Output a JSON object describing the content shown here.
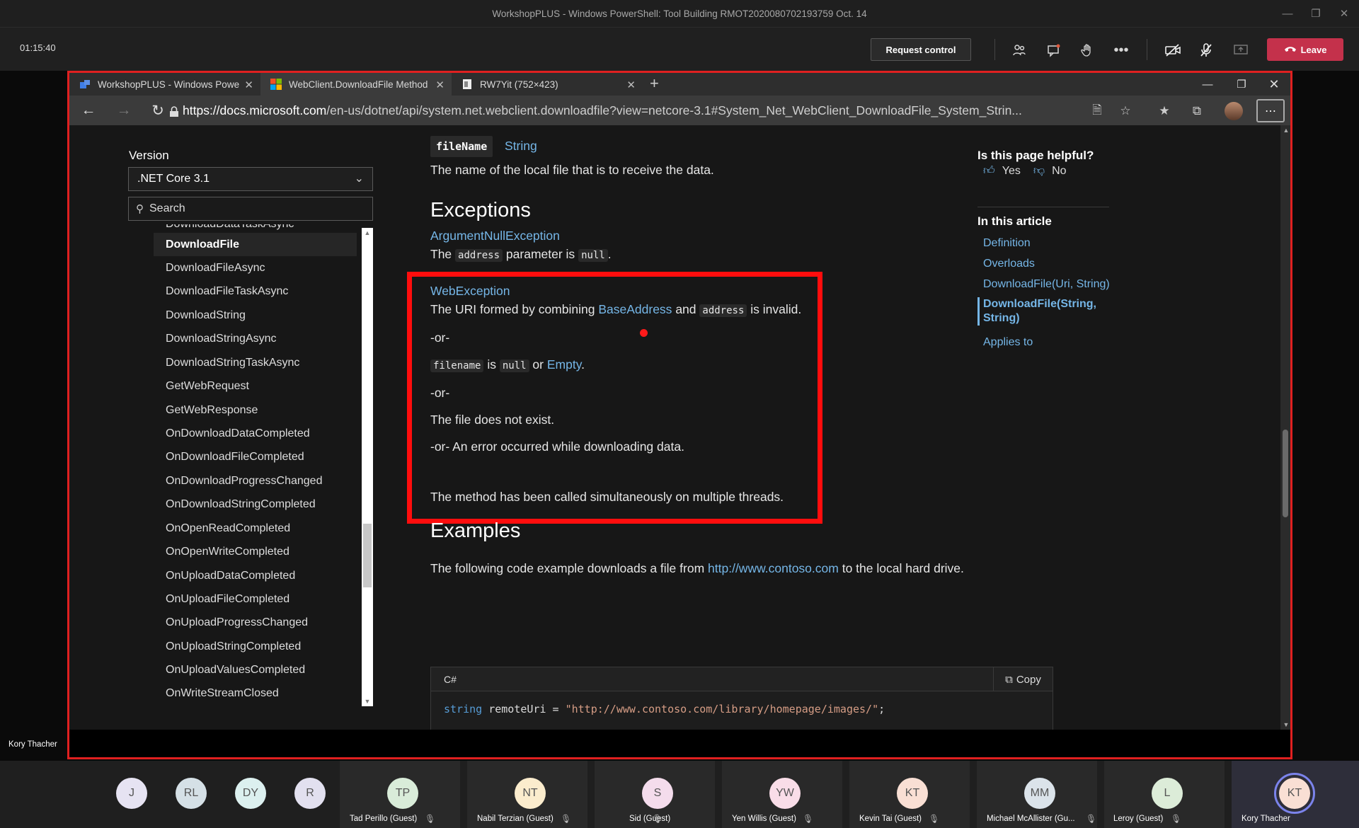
{
  "meeting": {
    "title": "WorkshopPLUS - Windows PowerShell: Tool Building RMOT2020080702193759 Oct. 14",
    "timer": "01:15:40",
    "request_control": "Request control",
    "leave": "Leave",
    "presenter": "Kory Thacher"
  },
  "browser": {
    "tabs": [
      {
        "label": "WorkshopPLUS - Windows Powe"
      },
      {
        "label": "WebClient.DownloadFile Method"
      },
      {
        "label": "RW7Yit (752×423)"
      }
    ],
    "url_prefix": "https://",
    "url_domain": "docs.microsoft.com",
    "url_rest": "/en-us/dotnet/api/system.net.webclient.downloadfile?view=netcore-3.1#System_Net_WebClient_DownloadFile_System_Strin..."
  },
  "sidebar": {
    "version_label": "Version",
    "version_value": ".NET Core 3.1",
    "search_placeholder": "Search",
    "items": [
      "DownloadDataTaskAsync",
      "DownloadFile",
      "DownloadFileAsync",
      "DownloadFileTaskAsync",
      "DownloadString",
      "DownloadStringAsync",
      "DownloadStringTaskAsync",
      "GetWebRequest",
      "GetWebResponse",
      "OnDownloadDataCompleted",
      "OnDownloadFileCompleted",
      "OnDownloadProgressChanged",
      "OnDownloadStringCompleted",
      "OnOpenReadCompleted",
      "OnOpenWriteCompleted",
      "OnUploadDataCompleted",
      "OnUploadFileCompleted",
      "OnUploadProgressChanged",
      "OnUploadStringCompleted",
      "OnUploadValuesCompleted",
      "OnWriteStreamClosed"
    ],
    "selected": "DownloadFile"
  },
  "content": {
    "param_name": "fileName",
    "param_type": "String",
    "param_desc": "The name of the local file that is to receive the data.",
    "exceptions_heading": "Exceptions",
    "ex1_link": "ArgumentNullException",
    "ex1_t1": "The",
    "ex1_code1": "address",
    "ex1_t2": "parameter is",
    "ex1_code2": "null",
    "ex1_t3": ".",
    "ex2_link": "WebException",
    "ex2_l1_t1": "The URI formed by combining",
    "ex2_l1_link": "BaseAddress",
    "ex2_l1_t2": "and",
    "ex2_l1_code": "address",
    "ex2_l1_t3": "is invalid.",
    "or": "-or-",
    "ex2_l2_code1": "filename",
    "ex2_l2_t1": "is",
    "ex2_l2_code2": "null",
    "ex2_l2_t2": "or",
    "ex2_l2_link": "Empty",
    "ex2_l2_t3": ".",
    "or2": "-or-",
    "ex2_l3": "The file does not exist.",
    "ex2_l4": "-or- An error occurred while downloading data.",
    "ex3_desc": "The method has been called simultaneously on multiple threads.",
    "examples_heading": "Examples",
    "ex_t1": "The following code example downloads a file from",
    "ex_link": "http://www.contoso.com",
    "ex_t2": "to the local hard drive.",
    "code_lang": "C#",
    "copy": "Copy",
    "code_kw": "string",
    "code_mid": " remoteUri = ",
    "code_str": "\"http://www.contoso.com/library/homepage/images/\"",
    "code_end": ";"
  },
  "right": {
    "helpful": "Is this page helpful?",
    "yes": "Yes",
    "no": "No",
    "in_article": "In this article",
    "links": [
      "Definition",
      "Overloads",
      "DownloadFile(Uri, String)",
      "DownloadFile(String, String)",
      "Applies to"
    ]
  },
  "participants": [
    {
      "initials": "J",
      "color": "#e6e3f2"
    },
    {
      "initials": "RL",
      "color": "#d5e0e6"
    },
    {
      "initials": "DY",
      "color": "#dcf0ef"
    },
    {
      "initials": "R",
      "color": "#e2e0ef"
    },
    {
      "initials": "TP",
      "name": "Tad Perillo (Guest)",
      "color": "#d9ecd9"
    },
    {
      "initials": "NT",
      "name": "Nabil Terzian (Guest)",
      "color": "#fbeccd"
    },
    {
      "initials": "S",
      "name": "Sid (Guest)",
      "color": "#f4dcec"
    },
    {
      "initials": "YW",
      "name": "Yen Willis (Guest)",
      "color": "#f9dde8"
    },
    {
      "initials": "KT",
      "name": "Kevin Tai (Guest)",
      "color": "#f9dfd4"
    },
    {
      "initials": "MM",
      "name": "Michael McAllister (Gu...",
      "color": "#dbe3ea"
    },
    {
      "initials": "L",
      "name": "Leroy (Guest)",
      "color": "#dcecd8"
    },
    {
      "initials": "KT",
      "name": "Kory Thacher",
      "color": "#f9dfd4"
    }
  ],
  "colors": {
    "accent_red": "#ff0d0d",
    "link": "#75b6e7",
    "leave": "#c4314b"
  }
}
